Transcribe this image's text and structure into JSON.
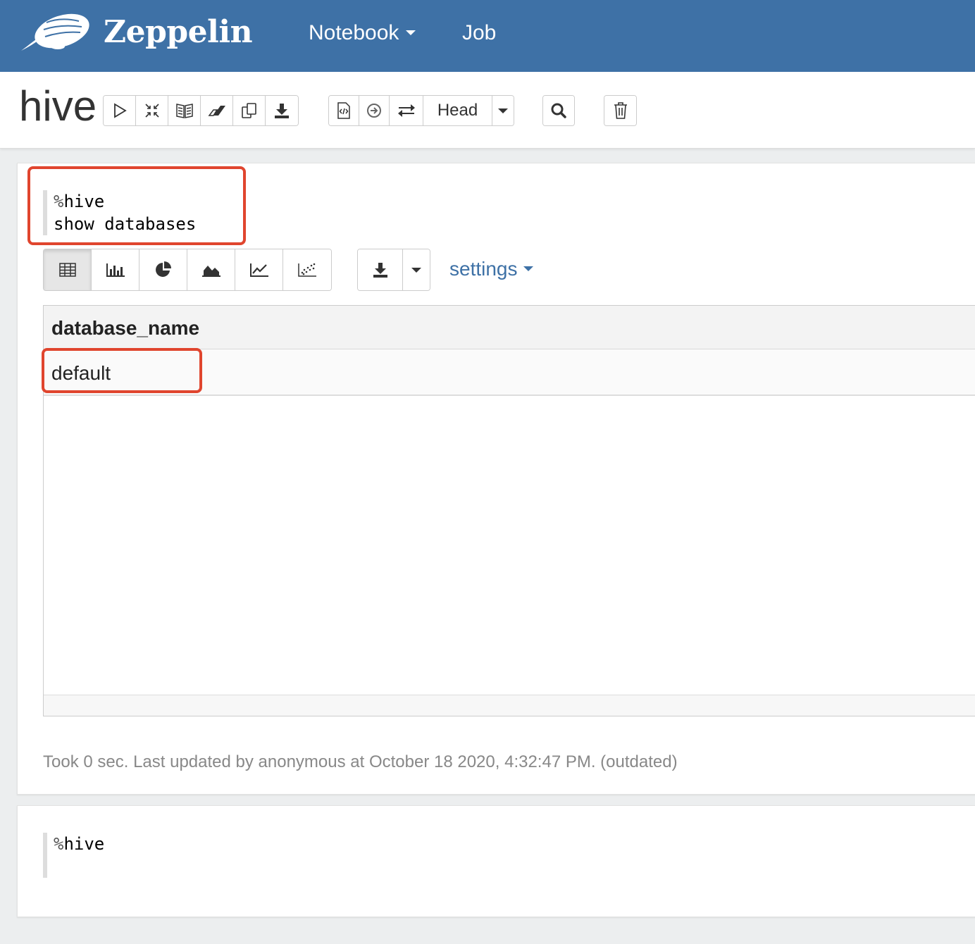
{
  "navbar": {
    "brand": "Zeppelin",
    "notebook_label": "Notebook",
    "job_label": "Job"
  },
  "header": {
    "title": "hive",
    "head_label": "Head"
  },
  "paragraph1": {
    "editor_line1_prefix": "%",
    "editor_line1_rest": "hive",
    "editor_line2": "show databases",
    "settings_label": "settings",
    "table": {
      "columns": [
        "database_name"
      ],
      "rows": [
        [
          "default"
        ]
      ]
    },
    "status": "Took 0 sec. Last updated by anonymous at October 18 2020, 4:32:47 PM. (outdated)"
  },
  "paragraph2": {
    "editor_line1_prefix": "%",
    "editor_line1_rest": "hive"
  },
  "colors": {
    "navbar_bg": "#3e71a6",
    "highlight": "#e0452e",
    "link": "#3e71a6"
  }
}
